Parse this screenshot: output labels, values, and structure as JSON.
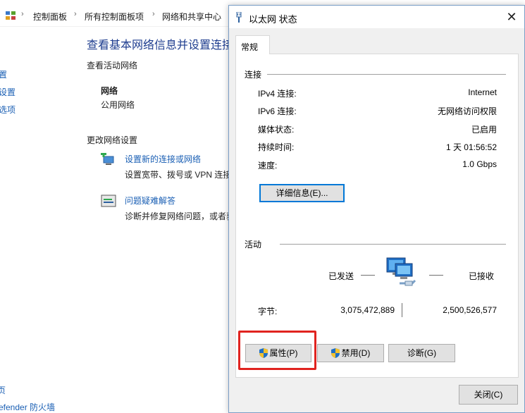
{
  "background": {
    "breadcrumb": [
      "控制面板",
      "所有控制面板项",
      "网络和共享中心"
    ],
    "heading": "查看基本网络信息并设置连接",
    "active_networks_label": "查看活动网络",
    "network_name": "网络",
    "network_type": "公用网络",
    "change_settings_label": "更改网络设置",
    "tasks": [
      {
        "link": "设置新的连接或网络",
        "desc": "设置宽带、拨号或 VPN 连接"
      },
      {
        "link": "问题疑难解答",
        "desc": "诊断并修复网络问题，或者获"
      }
    ],
    "sidebar": [
      "置",
      "设置",
      "选项"
    ],
    "sidebar_bottom": [
      "页",
      "efender 防火墙"
    ]
  },
  "dialog": {
    "title": "以太网 状态",
    "tab": "常规",
    "connection": {
      "section_label": "连接",
      "rows": [
        {
          "label": "IPv4 连接:",
          "value": "Internet"
        },
        {
          "label": "IPv6 连接:",
          "value": "无网络访问权限"
        },
        {
          "label": "媒体状态:",
          "value": "已启用"
        },
        {
          "label": "持续时间:",
          "value": "1 天 01:56:52"
        },
        {
          "label": "速度:",
          "value": "1.0 Gbps"
        }
      ],
      "details_button": "详细信息(E)..."
    },
    "activity": {
      "section_label": "活动",
      "sent_label": "已发送",
      "received_label": "已接收",
      "bytes_label": "字节:",
      "bytes_sent": "3,075,472,889",
      "bytes_received": "2,500,526,577"
    },
    "buttons": {
      "properties": "属性(P)",
      "disable": "禁用(D)",
      "diagnose": "诊断(G)",
      "close": "关闭(C)"
    }
  },
  "colors": {
    "link": "#1a5fb4",
    "highlight": "#e0231f",
    "focus": "#0078d7"
  }
}
